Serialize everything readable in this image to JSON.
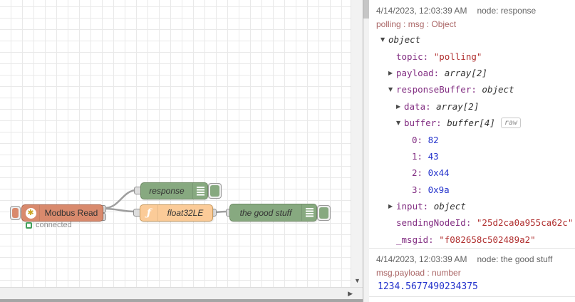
{
  "icons": {
    "collapse": "▼",
    "expand": "▶",
    "scroll_down": "▼",
    "scroll_right": "▶",
    "modbus_glyph": "✱",
    "function_glyph": "ƒ"
  },
  "colors": {
    "modbus-node": "#d98a6d",
    "modbus-border": "#ac654c",
    "debug-node": "#87a980",
    "debug-border": "#6e8a64",
    "function-node": "#fbcb98",
    "function-border": "#c79a5e",
    "status-green": "#44a05b",
    "key": "#822e82",
    "string": "#b02f2f",
    "number": "#2433cc",
    "meta": "#aa6666",
    "timestamp": "#636363"
  },
  "flow": {
    "modbus": {
      "label": "Modbus Read",
      "status": "connected"
    },
    "response": {
      "label": "response"
    },
    "func": {
      "label": "float32LE"
    },
    "good": {
      "label": "the good stuff"
    }
  },
  "debug": {
    "messages": [
      {
        "timestamp": "4/14/2023, 12:03:39 AM",
        "node_label": "node: response",
        "meta": "polling : msg : Object",
        "tree": [
          {
            "indent": 0,
            "arrow": "down",
            "key": null,
            "value": "object",
            "kind": "type"
          },
          {
            "indent": 1,
            "arrow": null,
            "key": "topic",
            "value": "\"polling\"",
            "kind": "string"
          },
          {
            "indent": 1,
            "arrow": "right",
            "key": "payload",
            "value": "array[2]",
            "kind": "type"
          },
          {
            "indent": 1,
            "arrow": "down",
            "key": "responseBuffer",
            "value": "object",
            "kind": "type"
          },
          {
            "indent": 2,
            "arrow": "right",
            "key": "data",
            "value": "array[2]",
            "kind": "type"
          },
          {
            "indent": 2,
            "arrow": "down",
            "key": "buffer",
            "value": "buffer[4]",
            "kind": "type",
            "badge": "raw"
          },
          {
            "indent": 3,
            "arrow": null,
            "key": "0",
            "value": "82",
            "kind": "number"
          },
          {
            "indent": 3,
            "arrow": null,
            "key": "1",
            "value": "43",
            "kind": "number"
          },
          {
            "indent": 3,
            "arrow": null,
            "key": "2",
            "value": "0x44",
            "kind": "number"
          },
          {
            "indent": 3,
            "arrow": null,
            "key": "3",
            "value": "0x9a",
            "kind": "number"
          },
          {
            "indent": 1,
            "arrow": "right",
            "key": "input",
            "value": "object",
            "kind": "type"
          },
          {
            "indent": 1,
            "arrow": null,
            "key": "sendingNodeId",
            "value": "\"25d2ca0a955ca62c\"",
            "kind": "string"
          },
          {
            "indent": 1,
            "arrow": null,
            "key": "_msgid",
            "value": "\"f082658c502489a2\"",
            "kind": "string"
          }
        ]
      },
      {
        "timestamp": "4/14/2023, 12:03:39 AM",
        "node_label": "node: the good stuff",
        "meta": "msg.payload : number",
        "payload": "1234.5677490234375"
      }
    ]
  }
}
